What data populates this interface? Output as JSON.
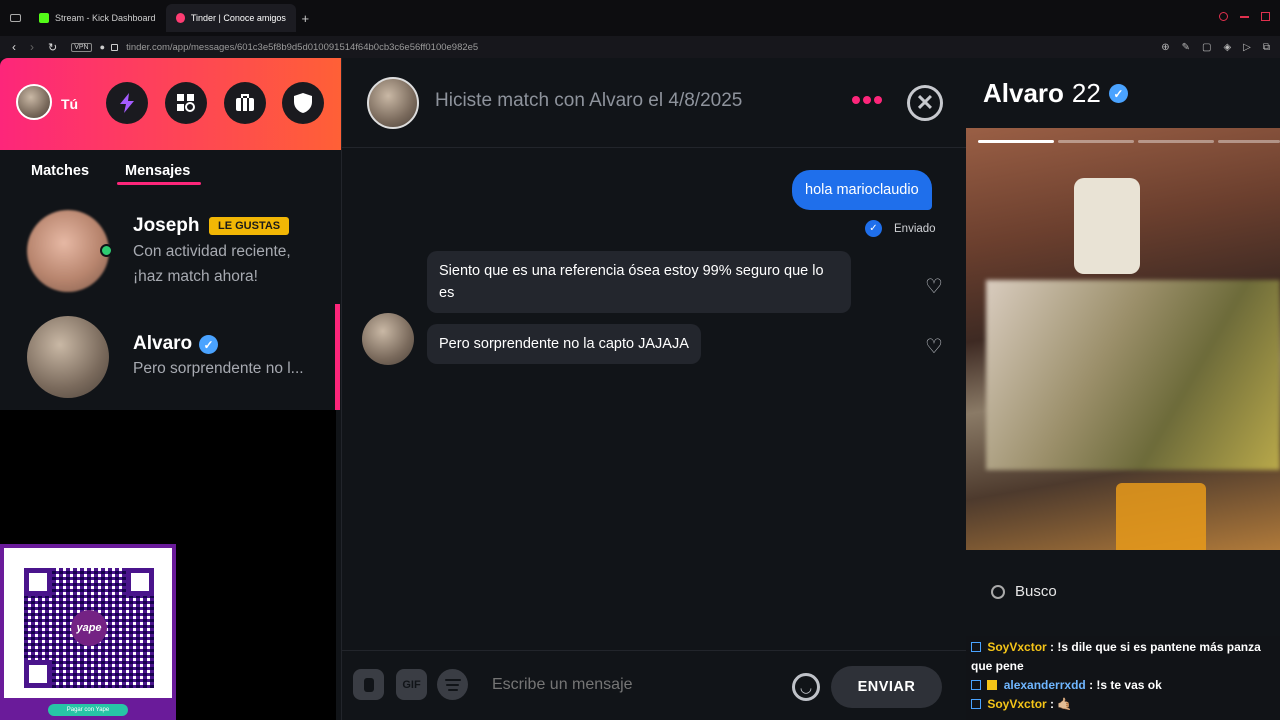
{
  "browser": {
    "tabs": [
      {
        "label": "Stream - Kick Dashboard"
      },
      {
        "label": "Tinder | Conoce amigos y"
      }
    ],
    "url": "tinder.com/app/messages/601c3e5f8b9d5d010091514f64b0cb3c6e56ff0100e982e5",
    "vpn_badge": "VPN"
  },
  "sidebar": {
    "user_label": "Tú",
    "tabs": [
      {
        "label": "Matches"
      },
      {
        "label": "Mensajes"
      }
    ],
    "conversations": [
      {
        "name": "Joseph",
        "badge": "LE GUSTAS",
        "line1": "Con actividad reciente,",
        "line2": "¡haz match ahora!"
      },
      {
        "name": "Alvaro",
        "preview": "Pero sorprendente no l..."
      }
    ],
    "qr_caption": "Pagar con Yape",
    "qr_brand": "yape"
  },
  "chat": {
    "header": "Hiciste match con Alvaro el 4/8/2025",
    "messages": [
      {
        "from": "me",
        "text": "hola marioclaudio",
        "status": "Enviado"
      },
      {
        "from": "them",
        "text": "Siento que es una referencia ósea estoy 99% seguro que lo es"
      },
      {
        "from": "them",
        "text": "Pero sorprendente no la capto JAJAJA"
      }
    ],
    "composer_placeholder": "Escribe un mensaje",
    "gif_label": "GIF",
    "send_label": "ENVIAR"
  },
  "profile": {
    "name": "Alvaro",
    "age": "22",
    "search_label": "Busco"
  },
  "stream_chat": [
    {
      "user": "SoyVxctor",
      "text": ": !s dile que si es pantene más panza que pene",
      "color": "#f5c518"
    },
    {
      "user": "alexanderrxdd",
      "text": ": !s te vas ok",
      "color": "#6fb6ff"
    },
    {
      "user": "SoyVxctor",
      "text": ": 🤙🏼",
      "color": "#f5c518"
    }
  ],
  "colors": {
    "brand_gradient_start": "#fd267a",
    "brand_gradient_end": "#ff6036",
    "sent_bubble": "#1f6feb",
    "gold_badge": "#f2b705",
    "verified": "#4aa3ff",
    "online": "#2ecc71"
  }
}
